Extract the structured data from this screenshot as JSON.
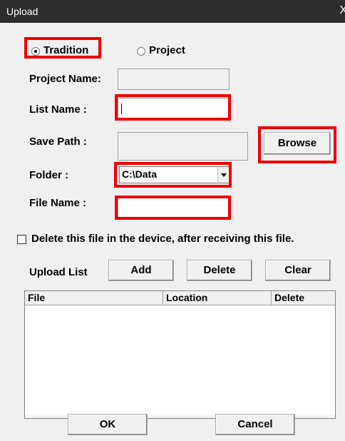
{
  "window": {
    "title": "Upload",
    "close_glyph": "X"
  },
  "mode": {
    "tradition_label": "Tradition",
    "project_label": "Project",
    "selected": "tradition"
  },
  "form": {
    "project_name_label": "Project Name:",
    "project_name_value": "",
    "list_name_label": "List Name :",
    "list_name_value": "",
    "save_path_label": "Save Path :",
    "save_path_value": "",
    "browse_label": "Browse",
    "folder_label": "Folder :",
    "folder_value": "C:\\Data",
    "file_name_label": "File Name :",
    "file_name_value": ""
  },
  "delete_option": {
    "label": "Delete this file in the device, after receiving this file.",
    "checked": false
  },
  "upload_list": {
    "label": "Upload List",
    "add_label": "Add",
    "delete_label": "Delete",
    "clear_label": "Clear",
    "columns": [
      "File",
      "Location",
      "Delete"
    ],
    "rows": []
  },
  "footer": {
    "ok_label": "OK",
    "cancel_label": "Cancel"
  },
  "highlight_color": "#ee0000"
}
